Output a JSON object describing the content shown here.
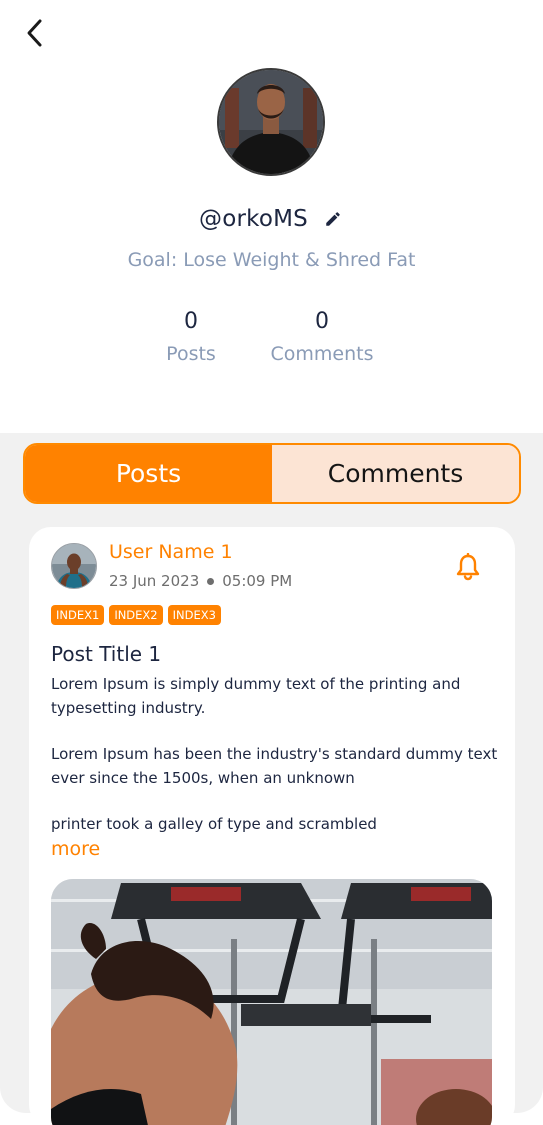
{
  "header": {
    "back_icon": "chevron-left-icon"
  },
  "profile": {
    "username": "@orkoMS",
    "edit_icon": "pencil-icon",
    "goal": "Goal: Lose Weight & Shred Fat",
    "stats": [
      {
        "value": "0",
        "label": "Posts"
      },
      {
        "value": "0",
        "label": "Comments"
      }
    ]
  },
  "tabs": [
    {
      "label": "Posts",
      "active": true
    },
    {
      "label": "Comments",
      "active": false
    }
  ],
  "post": {
    "user_name": "User Name 1",
    "date": "23 Jun 2023",
    "time": "05:09 PM",
    "bell_icon": "bell-icon",
    "tags": [
      "INDEX1",
      "INDEX2",
      "INDEX3"
    ],
    "title": "Post Title 1",
    "body": [
      "Lorem Ipsum is simply dummy text of the printing and typesetting industry.",
      "Lorem Ipsum has been the industry's standard dummy text ever since the 1500s, when an unknown",
      "printer took a galley of type and scrambled"
    ],
    "more_label": "more"
  },
  "colors": {
    "accent": "#ff8200",
    "tab_inactive_bg": "#fce4d4",
    "text_dark": "#1d2640",
    "text_muted": "#8a9bb6",
    "content_bg": "#f1f1f1"
  }
}
